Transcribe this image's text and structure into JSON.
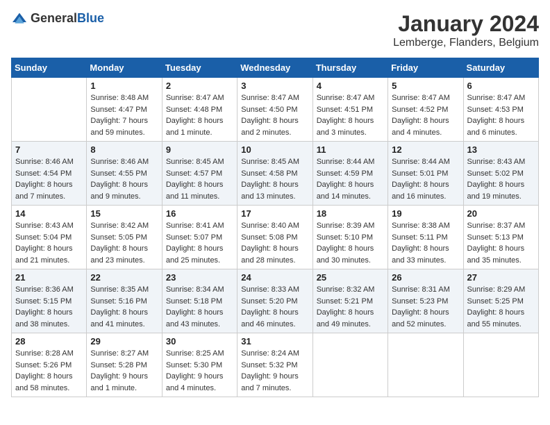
{
  "logo": {
    "general": "General",
    "blue": "Blue"
  },
  "title": {
    "month_year": "January 2024",
    "location": "Lemberge, Flanders, Belgium"
  },
  "days_of_week": [
    "Sunday",
    "Monday",
    "Tuesday",
    "Wednesday",
    "Thursday",
    "Friday",
    "Saturday"
  ],
  "weeks": [
    [
      {
        "day": "",
        "info": ""
      },
      {
        "day": "1",
        "info": "Sunrise: 8:48 AM\nSunset: 4:47 PM\nDaylight: 7 hours\nand 59 minutes."
      },
      {
        "day": "2",
        "info": "Sunrise: 8:47 AM\nSunset: 4:48 PM\nDaylight: 8 hours\nand 1 minute."
      },
      {
        "day": "3",
        "info": "Sunrise: 8:47 AM\nSunset: 4:50 PM\nDaylight: 8 hours\nand 2 minutes."
      },
      {
        "day": "4",
        "info": "Sunrise: 8:47 AM\nSunset: 4:51 PM\nDaylight: 8 hours\nand 3 minutes."
      },
      {
        "day": "5",
        "info": "Sunrise: 8:47 AM\nSunset: 4:52 PM\nDaylight: 8 hours\nand 4 minutes."
      },
      {
        "day": "6",
        "info": "Sunrise: 8:47 AM\nSunset: 4:53 PM\nDaylight: 8 hours\nand 6 minutes."
      }
    ],
    [
      {
        "day": "7",
        "info": "Sunrise: 8:46 AM\nSunset: 4:54 PM\nDaylight: 8 hours\nand 7 minutes."
      },
      {
        "day": "8",
        "info": "Sunrise: 8:46 AM\nSunset: 4:55 PM\nDaylight: 8 hours\nand 9 minutes."
      },
      {
        "day": "9",
        "info": "Sunrise: 8:45 AM\nSunset: 4:57 PM\nDaylight: 8 hours\nand 11 minutes."
      },
      {
        "day": "10",
        "info": "Sunrise: 8:45 AM\nSunset: 4:58 PM\nDaylight: 8 hours\nand 13 minutes."
      },
      {
        "day": "11",
        "info": "Sunrise: 8:44 AM\nSunset: 4:59 PM\nDaylight: 8 hours\nand 14 minutes."
      },
      {
        "day": "12",
        "info": "Sunrise: 8:44 AM\nSunset: 5:01 PM\nDaylight: 8 hours\nand 16 minutes."
      },
      {
        "day": "13",
        "info": "Sunrise: 8:43 AM\nSunset: 5:02 PM\nDaylight: 8 hours\nand 19 minutes."
      }
    ],
    [
      {
        "day": "14",
        "info": "Sunrise: 8:43 AM\nSunset: 5:04 PM\nDaylight: 8 hours\nand 21 minutes."
      },
      {
        "day": "15",
        "info": "Sunrise: 8:42 AM\nSunset: 5:05 PM\nDaylight: 8 hours\nand 23 minutes."
      },
      {
        "day": "16",
        "info": "Sunrise: 8:41 AM\nSunset: 5:07 PM\nDaylight: 8 hours\nand 25 minutes."
      },
      {
        "day": "17",
        "info": "Sunrise: 8:40 AM\nSunset: 5:08 PM\nDaylight: 8 hours\nand 28 minutes."
      },
      {
        "day": "18",
        "info": "Sunrise: 8:39 AM\nSunset: 5:10 PM\nDaylight: 8 hours\nand 30 minutes."
      },
      {
        "day": "19",
        "info": "Sunrise: 8:38 AM\nSunset: 5:11 PM\nDaylight: 8 hours\nand 33 minutes."
      },
      {
        "day": "20",
        "info": "Sunrise: 8:37 AM\nSunset: 5:13 PM\nDaylight: 8 hours\nand 35 minutes."
      }
    ],
    [
      {
        "day": "21",
        "info": "Sunrise: 8:36 AM\nSunset: 5:15 PM\nDaylight: 8 hours\nand 38 minutes."
      },
      {
        "day": "22",
        "info": "Sunrise: 8:35 AM\nSunset: 5:16 PM\nDaylight: 8 hours\nand 41 minutes."
      },
      {
        "day": "23",
        "info": "Sunrise: 8:34 AM\nSunset: 5:18 PM\nDaylight: 8 hours\nand 43 minutes."
      },
      {
        "day": "24",
        "info": "Sunrise: 8:33 AM\nSunset: 5:20 PM\nDaylight: 8 hours\nand 46 minutes."
      },
      {
        "day": "25",
        "info": "Sunrise: 8:32 AM\nSunset: 5:21 PM\nDaylight: 8 hours\nand 49 minutes."
      },
      {
        "day": "26",
        "info": "Sunrise: 8:31 AM\nSunset: 5:23 PM\nDaylight: 8 hours\nand 52 minutes."
      },
      {
        "day": "27",
        "info": "Sunrise: 8:29 AM\nSunset: 5:25 PM\nDaylight: 8 hours\nand 55 minutes."
      }
    ],
    [
      {
        "day": "28",
        "info": "Sunrise: 8:28 AM\nSunset: 5:26 PM\nDaylight: 8 hours\nand 58 minutes."
      },
      {
        "day": "29",
        "info": "Sunrise: 8:27 AM\nSunset: 5:28 PM\nDaylight: 9 hours\nand 1 minute."
      },
      {
        "day": "30",
        "info": "Sunrise: 8:25 AM\nSunset: 5:30 PM\nDaylight: 9 hours\nand 4 minutes."
      },
      {
        "day": "31",
        "info": "Sunrise: 8:24 AM\nSunset: 5:32 PM\nDaylight: 9 hours\nand 7 minutes."
      },
      {
        "day": "",
        "info": ""
      },
      {
        "day": "",
        "info": ""
      },
      {
        "day": "",
        "info": ""
      }
    ]
  ]
}
